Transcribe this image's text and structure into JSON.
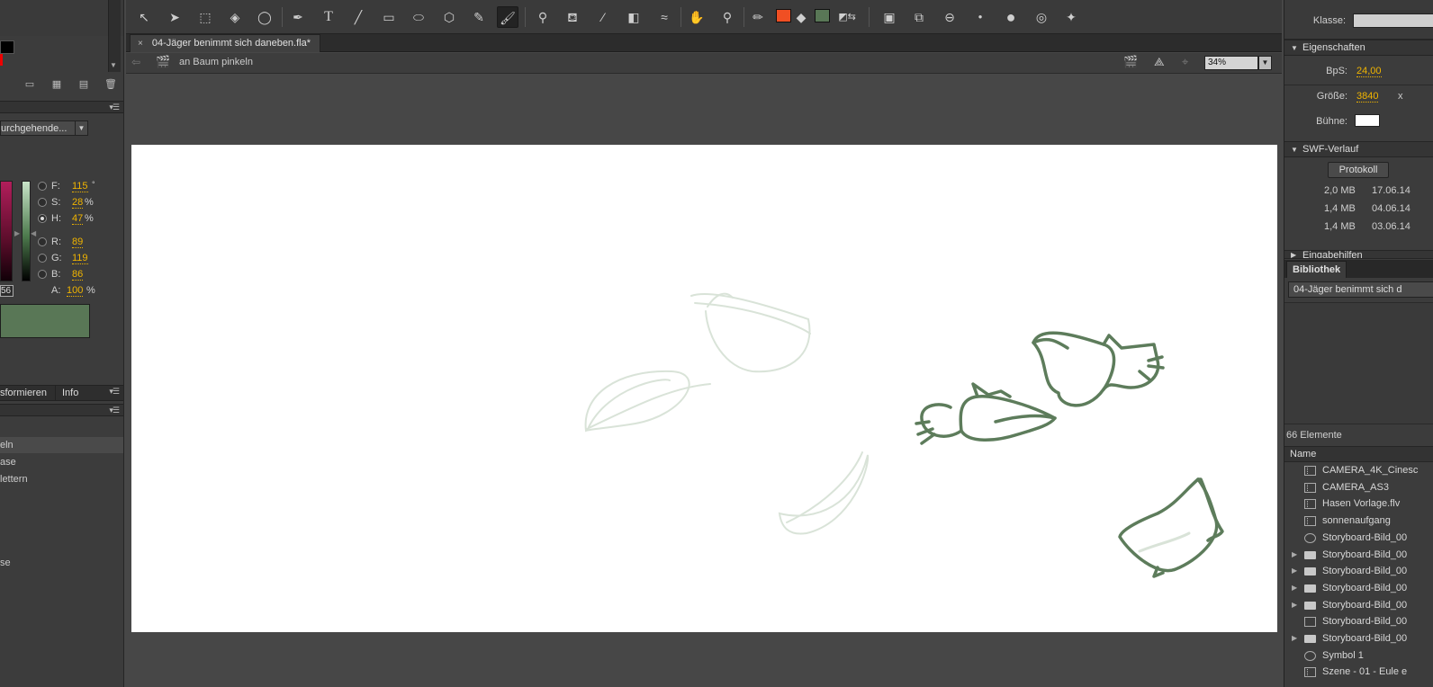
{
  "left_panel": {
    "blend_mode": "urchgehende...",
    "color": {
      "F": "115",
      "F_unit": "°",
      "S": "28",
      "S_unit": "%",
      "H": "47",
      "H_unit": "%",
      "R": "89",
      "G": "119",
      "B": "86",
      "A": "100",
      "A_unit": "%",
      "hex_partial": "56",
      "swatch_color": "#597756"
    },
    "tabs": {
      "transform": "sformieren",
      "info": "Info"
    },
    "list_items": [
      "eln",
      "ase",
      "lettern",
      "se"
    ]
  },
  "tab": {
    "close": "×",
    "title": "04-Jäger benimmt sich daneben.fla*"
  },
  "editbar": {
    "scene_name": "an Baum pinkeln",
    "zoom": "34%"
  },
  "toolbar": {
    "stroke_color": "#f04f23",
    "fill_color": "#597756"
  },
  "right_panel": {
    "klasse_label": "Klasse:",
    "eigenschaften": "Eigenschaften",
    "bps_label": "BpS:",
    "bps_value": "24,00",
    "groesse_label": "Größe:",
    "groesse_value": "3840",
    "groesse_x": "x",
    "buehne_label": "Bühne:",
    "swf_verlauf": "SWF-Verlauf",
    "protokoll": "Protokoll",
    "history": [
      {
        "size": "2,0 MB",
        "date": "17.06.14"
      },
      {
        "size": "1,4 MB",
        "date": "04.06.14"
      },
      {
        "size": "1,4 MB",
        "date": "03.06.14"
      }
    ],
    "eingabehilfen": "Eingabehilfen",
    "bibliothek": "Bibliothek",
    "library_doc": "04-Jäger benimmt sich d",
    "element_count": "66 Elemente",
    "name_header": "Name",
    "library_items": [
      {
        "name": "CAMERA_4K_Cinesc",
        "icon": "movie-icon",
        "expandable": false
      },
      {
        "name": "CAMERA_AS3",
        "icon": "movie-icon",
        "expandable": false
      },
      {
        "name": "Hasen Vorlage.flv",
        "icon": "video-icon",
        "expandable": false
      },
      {
        "name": "sonnenaufgang",
        "icon": "movie-icon",
        "expandable": false
      },
      {
        "name": "Storyboard-Bild_00",
        "icon": "symbol-icon",
        "expandable": false
      },
      {
        "name": "Storyboard-Bild_00",
        "icon": "folder-icon",
        "expandable": true
      },
      {
        "name": "Storyboard-Bild_00",
        "icon": "folder-icon",
        "expandable": true
      },
      {
        "name": "Storyboard-Bild_00",
        "icon": "folder-icon",
        "expandable": true
      },
      {
        "name": "Storyboard-Bild_00",
        "icon": "folder-icon",
        "expandable": true
      },
      {
        "name": "Storyboard-Bild_00",
        "icon": "bitmap-icon",
        "expandable": false
      },
      {
        "name": "Storyboard-Bild_00",
        "icon": "folder-icon",
        "expandable": true
      },
      {
        "name": "Symbol 1",
        "icon": "symbol-icon",
        "expandable": false
      },
      {
        "name": "Szene - 01 - Eule e",
        "icon": "movie-icon",
        "expandable": false
      }
    ]
  }
}
